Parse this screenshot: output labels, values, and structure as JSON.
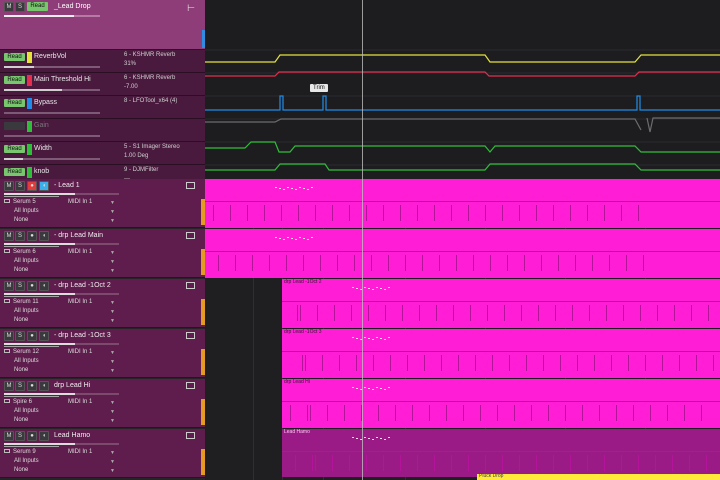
{
  "folder": {
    "mute": "M",
    "solo": "S",
    "mode": "Read",
    "name": "_Lead Drop"
  },
  "automation": [
    {
      "mode": "Read",
      "name": "ReverbVol",
      "device": "6 - KSHMR Reverb",
      "value": "31%",
      "color": "#e5e23b",
      "level": 0.31
    },
    {
      "mode": "Read",
      "name": "Main Threshold Hi",
      "device": "6 - KSHMR Reverb",
      "value": "-7.00",
      "color": "#e52e4e",
      "level": 0.6
    },
    {
      "mode": "Read",
      "name": "Bypass",
      "device": "8 - LFOTool_x64 (4)",
      "value": "",
      "color": "#1e8ce8",
      "level": 0
    },
    {
      "mode": "",
      "name": "Gain",
      "device": "",
      "value": "",
      "color": "#2fbe3a",
      "level": 0
    },
    {
      "mode": "Read",
      "name": "Width",
      "device": "5 - S1 Imager Stereo",
      "value": "1.00 Deg",
      "color": "#2fbe3a",
      "level": 0.2
    },
    {
      "mode": "Read",
      "name": "knob",
      "device": "9 - DJMFilter",
      "value": "---",
      "color": "#2fbe3a",
      "level": 0.15
    }
  ],
  "tracks": [
    {
      "name": "- Lead 1",
      "instrument": "Serum 5",
      "midi": "MIDI In 1",
      "input": "All Inputs",
      "output": "None",
      "volume": 0.62,
      "rec": true,
      "mon": true
    },
    {
      "name": "- drp Lead Main",
      "instrument": "Serum 6",
      "midi": "MIDI In 1",
      "input": "All Inputs",
      "output": "None",
      "volume": 0.62,
      "rec": false,
      "mon": false
    },
    {
      "name": "- drp Lead -1Oct 2",
      "instrument": "Serum 11",
      "midi": "MIDI In 1",
      "input": "All Inputs",
      "output": "None",
      "volume": 0.62,
      "rec": false,
      "mon": false
    },
    {
      "name": "- drp Lead -1Oct 3",
      "instrument": "Serum 12",
      "midi": "MIDI In 1",
      "input": "All Inputs",
      "output": "None",
      "volume": 0.62,
      "rec": false,
      "mon": false
    },
    {
      "name": "drp Lead Hi",
      "instrument": "Spire 6",
      "midi": "MIDI In 1",
      "input": "All Inputs",
      "output": "None",
      "volume": 0.62,
      "rec": false,
      "mon": false
    },
    {
      "name": "Lead Hamo",
      "instrument": "Serum 9",
      "midi": "MIDI In 1",
      "input": "All Inputs",
      "output": "None",
      "volume": 0.62,
      "rec": false,
      "mon": false
    }
  ],
  "clips": [
    {
      "label": ""
    },
    {
      "label": ""
    },
    {
      "label": "drp Lead -1Oct 2"
    },
    {
      "label": "drp Lead -1Oct 3"
    },
    {
      "label": "drp Lead Hi"
    },
    {
      "label": "Lead Hamo"
    }
  ],
  "tooltip": "Trim",
  "bottom_clip": "Pluck Drop",
  "labels": {
    "mute": "M",
    "solo": "S"
  }
}
